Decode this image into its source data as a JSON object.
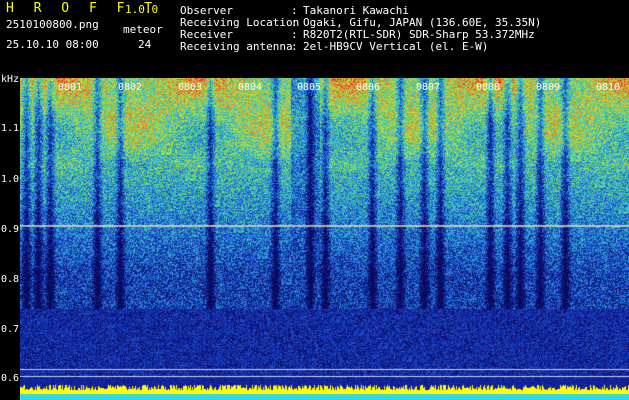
{
  "header": {
    "app_title": "H R O F F T",
    "version": "1.0.0",
    "filename": "2510100800.png",
    "meteor_label": "meteor",
    "datetime": "25.10.10 08:00",
    "meteor_count": "24"
  },
  "info": [
    {
      "label": "Observer",
      "value": "Takanori Kawachi"
    },
    {
      "label": "Receiving Location",
      "value": "Ogaki, Gifu, JAPAN (136.60E, 35.35N)"
    },
    {
      "label": "Receiver",
      "value": "R820T2(RTL-SDR) SDR-Sharp 53.372MHz"
    },
    {
      "label": "Receiving antenna",
      "value": "2el-HB9CV Vertical (el. E-W)"
    }
  ],
  "separator": ":",
  "y_unit": "kHz",
  "y_ticks": [
    "1.1",
    "1.0",
    "0.9",
    "0.8",
    "0.7",
    "0.6"
  ],
  "x_ticks": [
    "0801",
    "0802",
    "0803",
    "0804",
    "0805",
    "0806",
    "0807",
    "0808",
    "0809",
    "0810"
  ],
  "colors": {
    "text_yellow": "#ffff00",
    "text_white": "#ffffff",
    "background": "#000000",
    "signal_line": "#e8e0c0",
    "noise_floor": "#ffff00"
  }
}
